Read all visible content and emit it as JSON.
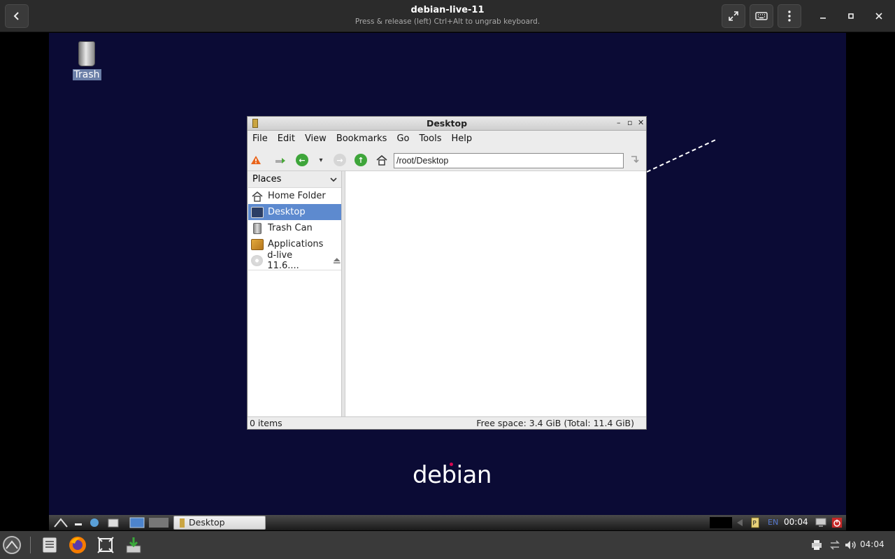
{
  "viewer": {
    "title": "debian-live-11",
    "subtitle": "Press & release (left) Ctrl+Alt to ungrab keyboard."
  },
  "desktop": {
    "trash_label": "Trash",
    "logo_text": "debian"
  },
  "file_manager": {
    "title": "Desktop",
    "menu": [
      "File",
      "Edit",
      "View",
      "Bookmarks",
      "Go",
      "Tools",
      "Help"
    ],
    "address": "/root/Desktop",
    "places_label": "Places",
    "places": [
      {
        "label": "Home Folder",
        "icon": "home-icon",
        "selected": false
      },
      {
        "label": "Desktop",
        "icon": "desktop-icon",
        "selected": true
      },
      {
        "label": "Trash Can",
        "icon": "trash-icon",
        "selected": false
      },
      {
        "label": "Applications",
        "icon": "applications-icon",
        "selected": false
      },
      {
        "label": "d-live 11.6....",
        "icon": "disc-icon",
        "selected": false
      }
    ],
    "status_left": "0 items",
    "status_right": "Free space: 3.4 GiB (Total: 11.4 GiB)"
  },
  "guest_panel": {
    "task_label": "Desktop",
    "lang": "EN",
    "clock": "00:04"
  },
  "host_taskbar": {
    "time": "04:04"
  },
  "colors": {
    "desktop_bg": "#0b0b35",
    "selection": "#5d8acf",
    "brand_red": "#d70751"
  }
}
